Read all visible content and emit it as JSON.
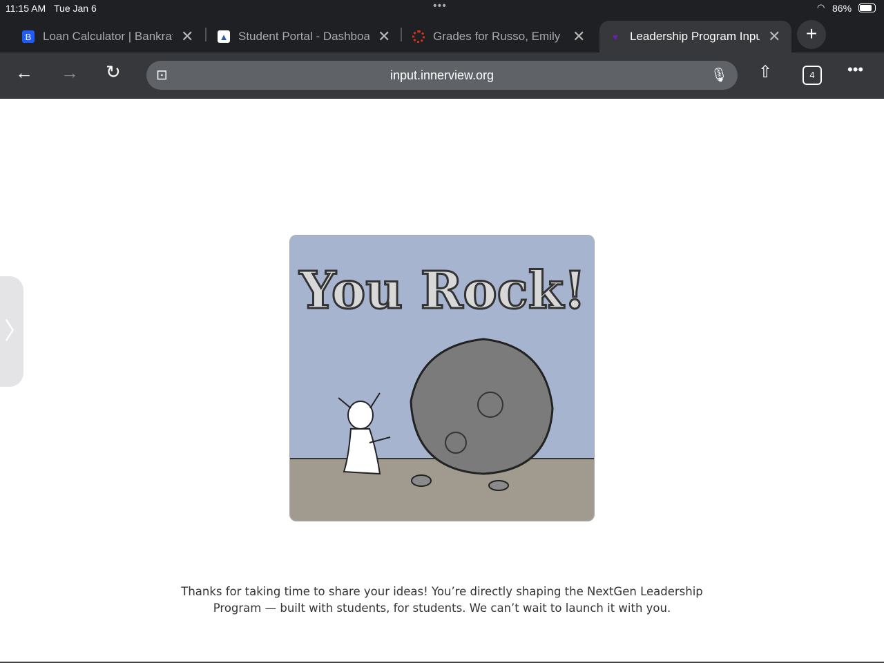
{
  "status": {
    "time": "11:15 AM",
    "date": "Tue Jan 6",
    "battery": "86%",
    "battery_level": 0.86
  },
  "tabs": [
    {
      "title": "Loan Calculator | Bankrate",
      "favicon": "B",
      "color": "#1e5cf5"
    },
    {
      "title": "Student Portal - Dashboard",
      "favicon": "",
      "color": "#ffffff"
    },
    {
      "title": "Grades for Russo, Emily",
      "favicon": "",
      "color": "#e0311f"
    },
    {
      "title": "Leadership Program Input",
      "favicon": "",
      "color": "#6b1fb5",
      "active": true
    }
  ],
  "toolbar": {
    "url": "input.innerview.org",
    "tab_count": "4"
  },
  "image": {
    "caption": "You Rock!"
  },
  "message": {
    "line1": "Thanks for taking  time to share your ideas! You’re directly shaping the NextGen Leadership",
    "line2": "Program — built with students, for students. We can’t wait to launch it with you."
  }
}
